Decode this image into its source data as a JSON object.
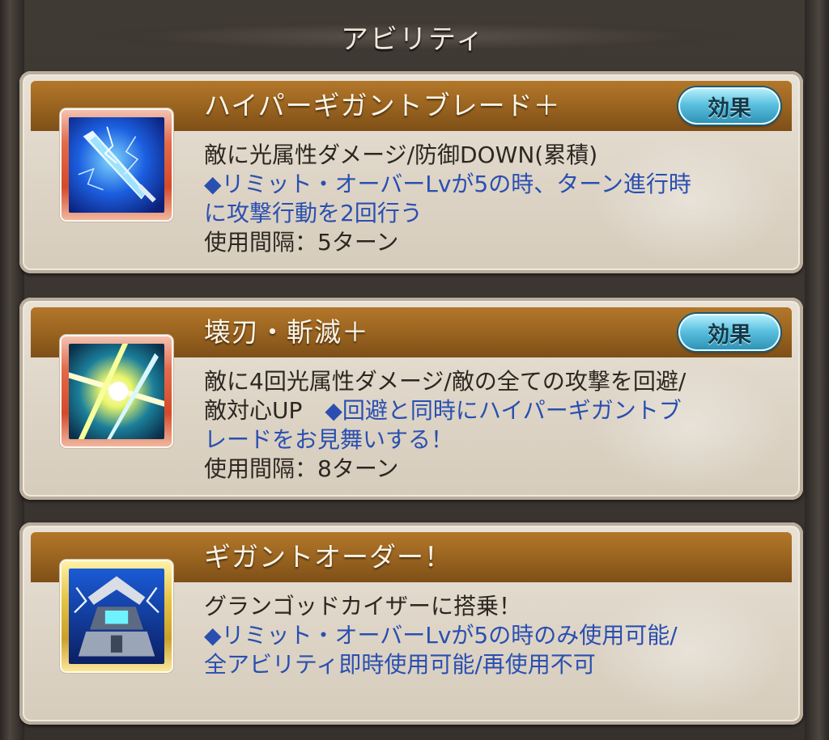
{
  "header": {
    "title": "アビリティ"
  },
  "abilities": [
    {
      "name": "ハイパーギガントブレード＋",
      "effect_label": "効果",
      "icon": "lightning-sword-icon",
      "desc_lines": [
        {
          "text": "敵に光属性ダメージ/防御DOWN(累積)",
          "color": "#2d2721"
        },
        {
          "text": "◆リミット・オーバーLvが5の時、ターン進行時",
          "color": "#2a4fb0"
        },
        {
          "text": "に攻撃行動を2回行う",
          "color": "#2a4fb0"
        },
        {
          "text": "使用間隔：5ターン",
          "color": "#2d2721"
        }
      ]
    },
    {
      "name": "壊刃・斬滅＋",
      "effect_label": "効果",
      "icon": "burst-slash-icon",
      "desc_lines": [
        {
          "text": "敵に4回光属性ダメージ/敵の全ての攻撃を回避/",
          "color": "#2d2721"
        },
        {
          "text_black": "敵対心UP　",
          "text_blue": "◆回避と同時にハイパーギガントブ"
        },
        {
          "text": "レードをお見舞いする！",
          "color": "#2a4fb0"
        },
        {
          "text": "使用間隔：8ターン",
          "color": "#2d2721"
        }
      ]
    },
    {
      "name": "ギガントオーダー！",
      "icon": "mecha-robot-icon",
      "desc_lines": [
        {
          "text": "グランゴッドカイザーに搭乗！",
          "color": "#2d2721"
        },
        {
          "text": "◆リミット・オーバーLvが5の時のみ使用可能/",
          "color": "#2a4fb0"
        },
        {
          "text": "全アビリティ即時使用可能/再使用不可",
          "color": "#2a4fb0"
        }
      ]
    }
  ]
}
